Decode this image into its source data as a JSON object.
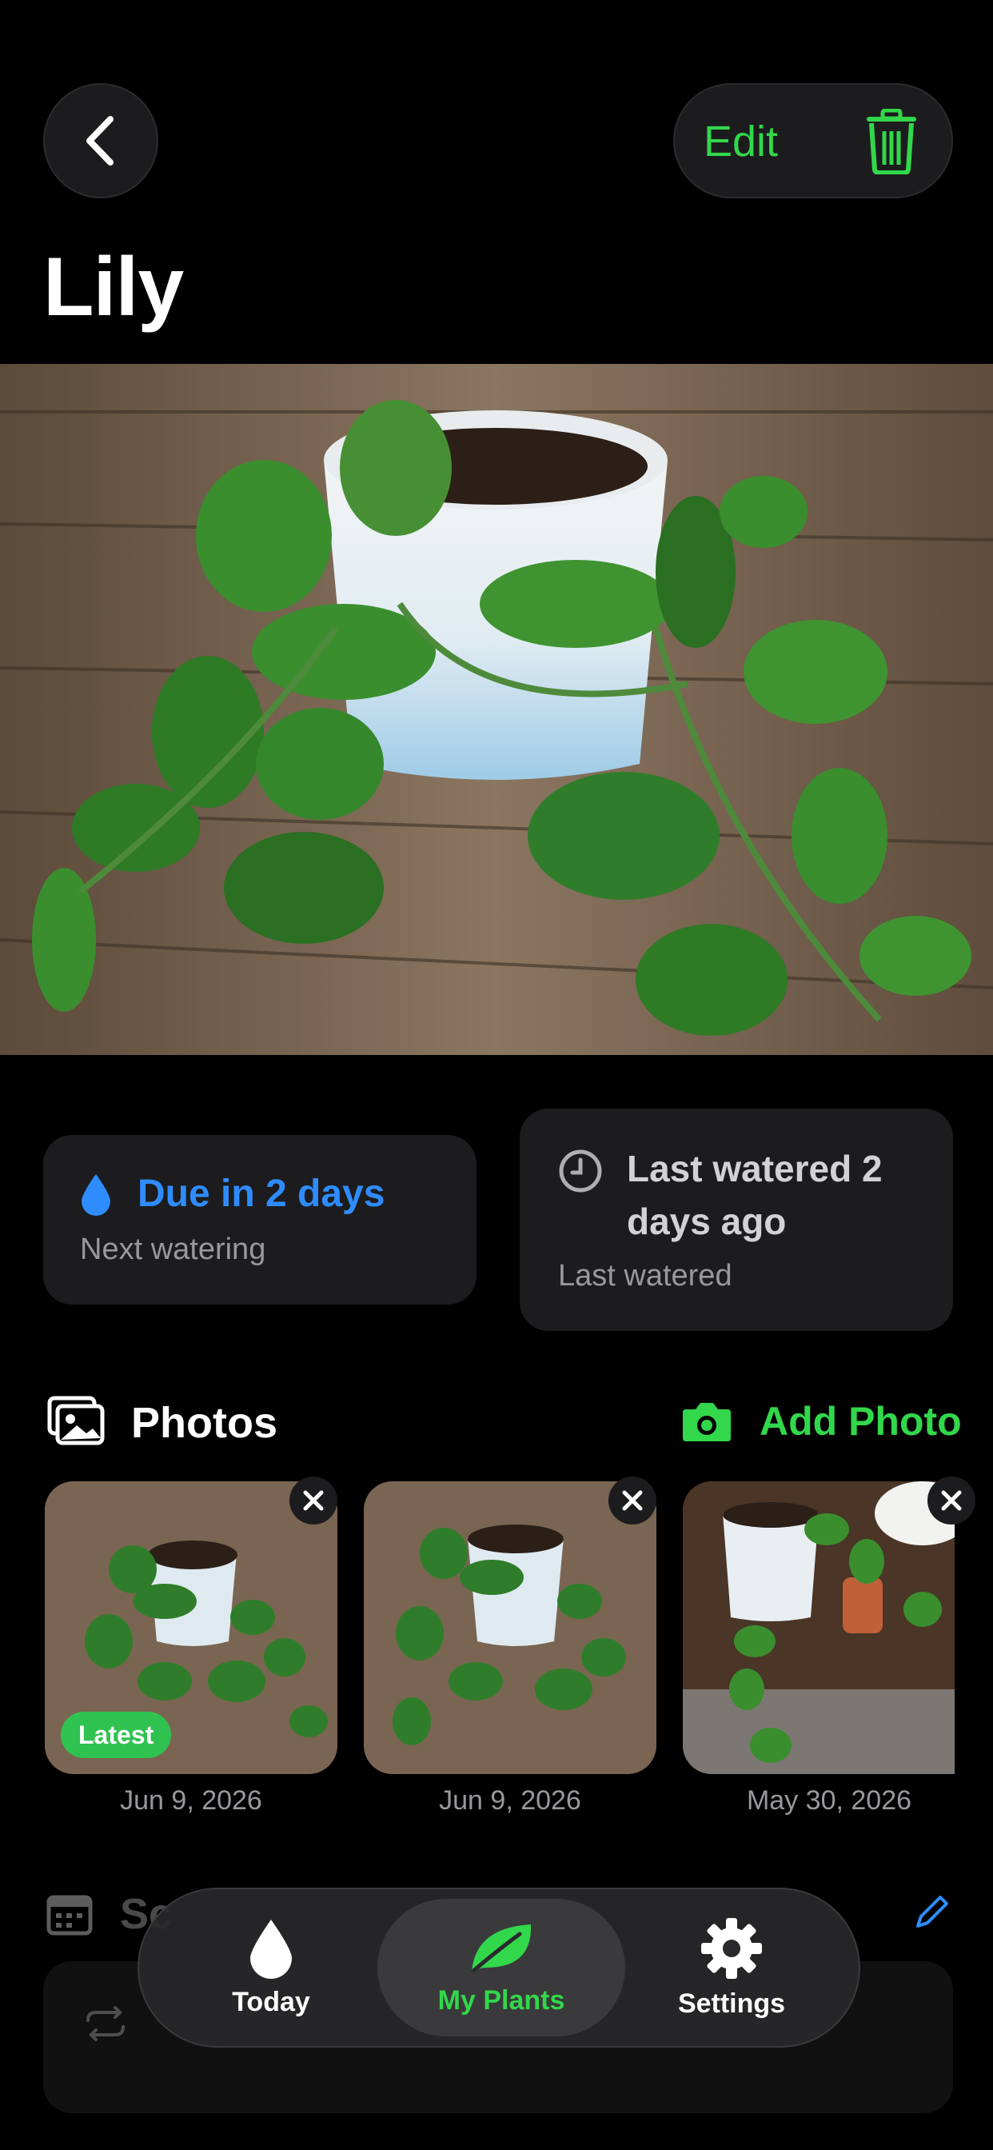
{
  "header": {
    "back_icon": "chevron-left-icon",
    "edit_label": "Edit",
    "delete_icon": "trash-icon",
    "title": "Lily"
  },
  "watering": {
    "due_text": "Due in 2 days",
    "due_caption": "Next watering",
    "last_text_line1": "Last watered 2",
    "last_text_line2": "days ago",
    "last_caption": "Last watered"
  },
  "photos": {
    "section_title": "Photos",
    "add_label": "Add Photo",
    "items": [
      {
        "date": "Jun 9, 2026",
        "badge": "Latest"
      },
      {
        "date": "Jun 9, 2026"
      },
      {
        "date": "May 30, 2026"
      }
    ]
  },
  "schedule": {
    "section_title_visible": "Sc"
  },
  "tabbar": {
    "tabs": [
      {
        "label": "Today",
        "icon": "drop-icon"
      },
      {
        "label": "My Plants",
        "icon": "leaf-icon",
        "active": true
      },
      {
        "label": "Settings",
        "icon": "gear-icon"
      }
    ]
  },
  "colors": {
    "accent_green": "#32d74b",
    "accent_blue": "#2f8cff",
    "card_bg": "#1c1c1e"
  }
}
